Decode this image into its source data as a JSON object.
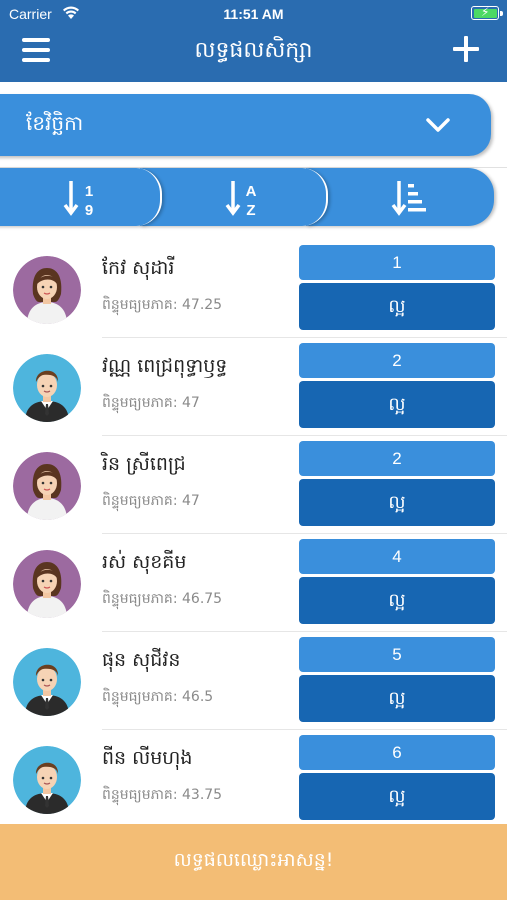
{
  "status_bar": {
    "carrier": "Carrier",
    "time": "11:51 AM"
  },
  "nav": {
    "title": "លទ្ធផលសិក្សា",
    "menu_icon": "hamburger-menu-icon",
    "add_icon": "plus-icon"
  },
  "month_select": {
    "value": "ខែវិច្ឆិកា",
    "icon": "chevron-down-icon"
  },
  "sort_options": [
    {
      "icon": "sort-numeric-icon",
      "label_top": "1",
      "label_bottom": "9"
    },
    {
      "icon": "sort-alpha-icon",
      "label_top": "A",
      "label_bottom": "Z"
    },
    {
      "icon": "sort-amount-icon"
    }
  ],
  "avg_label": "ពិន្ទុមធ្យមភាគ:",
  "students": [
    {
      "name": "កែវ សុដារី",
      "avg": "47.25",
      "rank": "1",
      "grade": "ល្អ",
      "gender": "female"
    },
    {
      "name": "វណ្ណ ពេជ្រពុទ្ធាឫទ្ធ",
      "avg": "47",
      "rank": "2",
      "grade": "ល្អ",
      "gender": "male"
    },
    {
      "name": "រិន ស្រីពេជ្រ",
      "avg": "47",
      "rank": "2",
      "grade": "ល្អ",
      "gender": "female"
    },
    {
      "name": "រស់ សុខគីម",
      "avg": "46.75",
      "rank": "4",
      "grade": "ល្អ",
      "gender": "female"
    },
    {
      "name": "ផុន សុជីវន",
      "avg": "46.5",
      "rank": "5",
      "grade": "ល្អ",
      "gender": "male"
    },
    {
      "name": "ពីន លីមហុង",
      "avg": "43.75",
      "rank": "6",
      "grade": "ល្អ",
      "gender": "male"
    }
  ],
  "footer": {
    "label": "លទ្ធផលឈ្លោះអាសន្ន!"
  },
  "colors": {
    "nav": "#2a6cb0",
    "primary": "#3a8fdc",
    "dark": "#1766b2",
    "footer": "#f3bd75",
    "female_bg": "#9c6aa0",
    "male_bg": "#4eb5dd"
  }
}
